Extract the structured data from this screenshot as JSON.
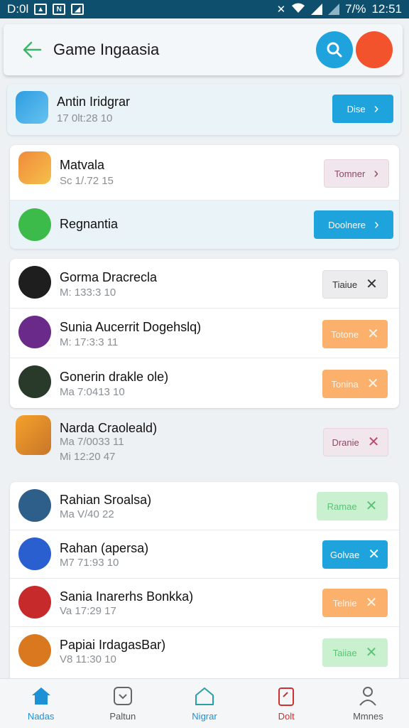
{
  "status_bar": {
    "time_left": "D:0l",
    "battery": "7/%",
    "clock": "12:51",
    "icons": [
      "image-icon",
      "n-icon",
      "photo-icon",
      "mute-icon",
      "wifi-icon",
      "signal-icon",
      "signal-icon"
    ]
  },
  "header": {
    "title": "Game Ingaasia"
  },
  "colors": {
    "accent": "#1ea3dc",
    "avatar": "#f2522c",
    "orange": "#fbb06c",
    "green": "#c9f0cf",
    "pink": "#f1e6ec"
  },
  "featured": {
    "name": "Antin Iridgrar",
    "meta": "17 0lt:28 10",
    "action": "Dise"
  },
  "group1": [
    {
      "name": "Matvala",
      "meta": "Sc 1/.72 15",
      "action": "Tomner"
    },
    {
      "name": "Regnantia",
      "meta": "",
      "action": "Doolnere"
    }
  ],
  "group2": [
    {
      "name": "Gorma Dracrecla",
      "meta": "M: 133:3 10",
      "action": "Tiaiue"
    },
    {
      "name": "Sunia Aucerrit Dogehslq)",
      "meta": "M: 17:3:3 11",
      "action": "Totone"
    },
    {
      "name": "Gonerin drakle ole)",
      "meta": "Ma 7:0413 10",
      "action": "Tonina"
    }
  ],
  "standalone": {
    "name": "Narda Craoleald)",
    "meta": "Ma 7/0033 11",
    "meta2": "Mi 12:20 47",
    "action": "Dranie"
  },
  "group3": [
    {
      "name": "Rahian Sroalsa)",
      "meta": "Ma V/40 22",
      "action": "Ramae"
    },
    {
      "name": "Rahan (apersa)",
      "meta": "M7 71:93 10",
      "action": "Golvae"
    },
    {
      "name": "Sania Inarerhs Bonkka)",
      "meta": "Va 17:29 17",
      "action": "Telnie"
    },
    {
      "name": "Papiai IrdagasBar)",
      "meta": "V8 11:30 10",
      "action": "Taiiae"
    }
  ],
  "bottom_nav": [
    {
      "label": "Nadas",
      "icon": "home-icon"
    },
    {
      "label": "Paltun",
      "icon": "inbox-icon"
    },
    {
      "label": "Nigrar",
      "icon": "house-outline-icon"
    },
    {
      "label": "Dolt",
      "icon": "clipboard-icon"
    },
    {
      "label": "Mmnes",
      "icon": "person-icon"
    }
  ]
}
